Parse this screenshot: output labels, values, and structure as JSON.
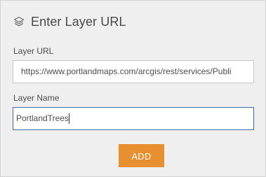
{
  "header": {
    "title": "Enter Layer URL",
    "icon": "layers-icon"
  },
  "url_field": {
    "label": "Layer URL",
    "value": "https://www.portlandmaps.com/arcgis/rest/services/Publi"
  },
  "name_field": {
    "label": "Layer Name",
    "value": "PortlandTrees"
  },
  "add_button": {
    "label": "ADD"
  },
  "colors": {
    "accent": "#e8902f",
    "focus_border": "#3b6e9e",
    "panel_bg": "#efefef"
  }
}
